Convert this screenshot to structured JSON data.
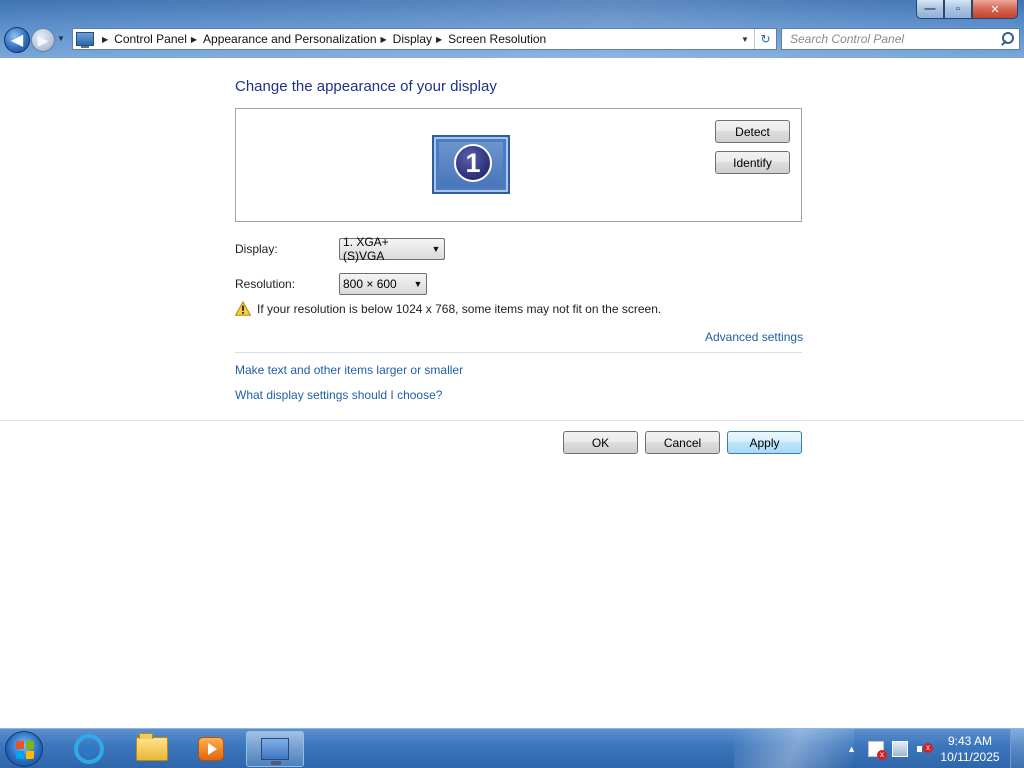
{
  "window": {
    "controls": {
      "minimize": "—",
      "maximize": "▫",
      "close": "✕"
    }
  },
  "navigation": {
    "back_glyph": "◀",
    "forward_glyph": "▶",
    "history_dropdown_glyph": "▼"
  },
  "address_bar": {
    "icon": "control-panel-icon",
    "breadcrumbs": [
      "Control Panel",
      "Appearance and Personalization",
      "Display",
      "Screen Resolution"
    ],
    "separator_glyph": "▶",
    "dropdown_glyph": "▼",
    "refresh_glyph": "↻"
  },
  "search": {
    "placeholder": "Search Control Panel",
    "icon": "search-icon"
  },
  "page": {
    "title": "Change the appearance of your display",
    "monitor_number": "1",
    "detect_label": "Detect",
    "identify_label": "Identify",
    "display_label": "Display:",
    "display_value": "1. XGA+(S)VGA",
    "resolution_label": "Resolution:",
    "resolution_value": "800 × 600",
    "warning_text": "If your resolution is below 1024 x 768, some items may not fit on the screen.",
    "advanced_settings_link": "Advanced settings",
    "text_size_link": "Make text and other items larger or smaller",
    "help_link": "What display settings should I choose?",
    "ok_label": "OK",
    "cancel_label": "Cancel",
    "apply_label": "Apply"
  },
  "taskbar": {
    "start_icon": "windows-start-icon",
    "pinned": [
      {
        "name": "internet-explorer-icon"
      },
      {
        "name": "file-explorer-icon"
      },
      {
        "name": "media-player-icon"
      },
      {
        "name": "display-settings-icon",
        "active": true
      }
    ],
    "tray": {
      "overflow_glyph": "▲",
      "icons": [
        "action-center-icon",
        "network-icon",
        "volume-muted-icon"
      ],
      "time": "9:43 AM",
      "date": "10/11/2025"
    }
  },
  "colors": {
    "heading": "#1e3287",
    "link": "#1f5fa8",
    "taskbar": "#3d77bd",
    "chrome": "#5c8fcb"
  }
}
